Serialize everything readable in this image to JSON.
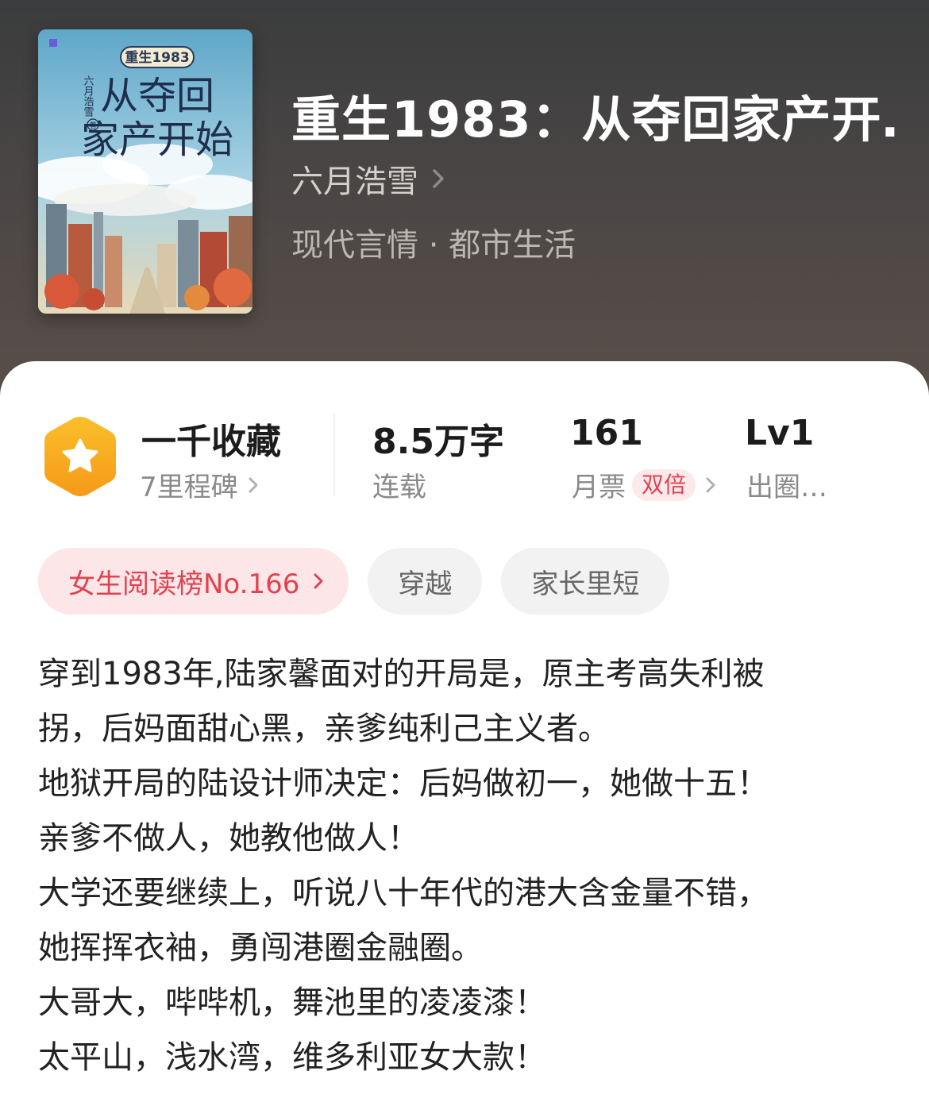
{
  "book": {
    "title": "重生1983：从夺回家产开…",
    "author": "六月浩雪",
    "category": "现代言情 · 都市生活",
    "cover": {
      "series_label": "重生1983",
      "title_line1": "从夺回",
      "title_line2": "家产开始",
      "author_vertical": "六月浩雪",
      "author_mark": "著"
    }
  },
  "stats": {
    "milestone": {
      "main": "一千收藏",
      "sub": "7里程碑",
      "icon": "star-hexagon-icon"
    },
    "words": {
      "main": "8.5万字",
      "sub": "连载"
    },
    "tickets": {
      "main": "161",
      "sub": "月票",
      "tag": "双倍"
    },
    "level": {
      "main": "Lv1",
      "sub": "出圈…"
    }
  },
  "tags": {
    "rank": "女生阅读榜No.166",
    "tag1": "穿越",
    "tag2": "家长里短"
  },
  "description": {
    "lines": [
      "穿到1983年,陆家馨面对的开局是，原主考高失利被",
      "拐，后妈面甜心黑，亲爹纯利己主义者。",
      "地狱开局的陆设计师决定：后妈做初一，她做十五！",
      "亲爹不做人，她教他做人！",
      "大学还要继续上，听说八十年代的港大含金量不错，",
      "她挥挥衣袖，勇闯港圈金融圈。",
      "大哥大，哔哔机，舞池里的凌凌漆！",
      "太平山，浅水湾，维多利亚女大款！"
    ]
  },
  "colors": {
    "accent_red": "#e0424f",
    "badge_orange": "#f7a21b",
    "header_dark": "#3b3c3d"
  }
}
